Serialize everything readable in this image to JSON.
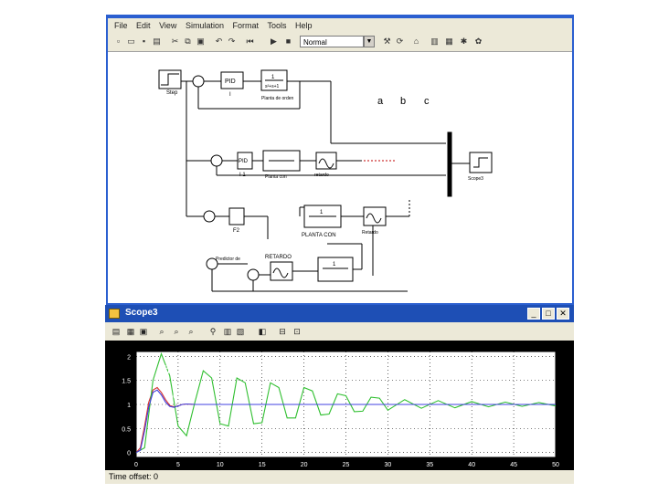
{
  "simulink": {
    "menu": [
      "File",
      "Edit",
      "View",
      "Simulation",
      "Format",
      "Tools",
      "Help"
    ],
    "sim_mode": "Normal",
    "blocks": {
      "step_label": "Step",
      "pid1": "PID",
      "pid1_sub": "I",
      "plant1_num": "1",
      "plant1_den": "s²+s+1",
      "plant1_label": "Planta de orden",
      "pid2": "PID",
      "pid2_sub": "I 1",
      "plant2_label": "Planta con",
      "delay1_label": "retardo",
      "pid3_sub": "F2",
      "plant3_num": "1",
      "plant3_label": "PLANTA CON",
      "delay2_label": "Retardo",
      "smith_label": "Predictor de",
      "retardo_label": "RETARDO",
      "plant4_num": "1",
      "scope_label": "Scope3"
    },
    "curve_tags": [
      "a",
      "b",
      "c"
    ]
  },
  "scope": {
    "title": "Scope3",
    "status": "Time offset:  0",
    "y_ticks": [
      "2",
      "1.5",
      "1",
      "0.5",
      "0"
    ],
    "x_ticks": [
      "0",
      "5",
      "10",
      "15",
      "20",
      "25",
      "30",
      "35",
      "40",
      "45",
      "50"
    ],
    "annotations": [
      "a",
      "b",
      "c"
    ]
  },
  "chart_data": {
    "type": "line",
    "x_range": [
      0,
      50
    ],
    "ylim": [
      -0.1,
      2.1
    ],
    "grid": true,
    "background": "#000000",
    "series": [
      {
        "name": "a",
        "color": "#d63030",
        "x": [
          0,
          0.5,
          1,
          1.5,
          2,
          2.5,
          3,
          3.5,
          4,
          4.5,
          5,
          5.5,
          6,
          7,
          8,
          9,
          10,
          12,
          15,
          20,
          30,
          40,
          50
        ],
        "y": [
          0,
          0.1,
          0.55,
          1.05,
          1.3,
          1.35,
          1.25,
          1.1,
          0.98,
          0.95,
          0.97,
          1.0,
          1.01,
          1.0,
          1.0,
          1.0,
          1.0,
          1.0,
          1.0,
          1.0,
          1.0,
          1.0,
          1.0
        ]
      },
      {
        "name": "b",
        "color": "#2fbf2f",
        "x": [
          0,
          1,
          2,
          3,
          4,
          5,
          6,
          7,
          8,
          9,
          10,
          11,
          12,
          13,
          14,
          15,
          16,
          17,
          18,
          19,
          20,
          21,
          22,
          23,
          24,
          25,
          26,
          27,
          28,
          29,
          30,
          32,
          34,
          36,
          38,
          40,
          42,
          44,
          46,
          48,
          50
        ],
        "y": [
          0,
          0.1,
          1.5,
          2.05,
          1.6,
          0.55,
          0.35,
          1.05,
          1.7,
          1.55,
          0.6,
          0.55,
          1.55,
          1.45,
          0.6,
          0.62,
          1.45,
          1.35,
          0.72,
          0.72,
          1.35,
          1.28,
          0.78,
          0.8,
          1.22,
          1.18,
          0.85,
          0.86,
          1.15,
          1.13,
          0.88,
          1.1,
          0.92,
          1.08,
          0.93,
          1.06,
          0.95,
          1.05,
          0.96,
          1.04,
          0.97
        ]
      },
      {
        "name": "c",
        "color": "#4040e0",
        "x": [
          0,
          0.5,
          1,
          1.5,
          2,
          2.5,
          3,
          3.5,
          4,
          4.5,
          5,
          5.5,
          6,
          7,
          8,
          9,
          10,
          12,
          15,
          20,
          30,
          40,
          50
        ],
        "y": [
          0,
          0.05,
          0.45,
          0.95,
          1.25,
          1.3,
          1.2,
          1.05,
          0.96,
          0.94,
          0.97,
          1.0,
          1.01,
          1.0,
          1.0,
          1.0,
          1.0,
          1.0,
          1.0,
          1.0,
          1.0,
          1.0,
          1.0
        ]
      }
    ]
  }
}
